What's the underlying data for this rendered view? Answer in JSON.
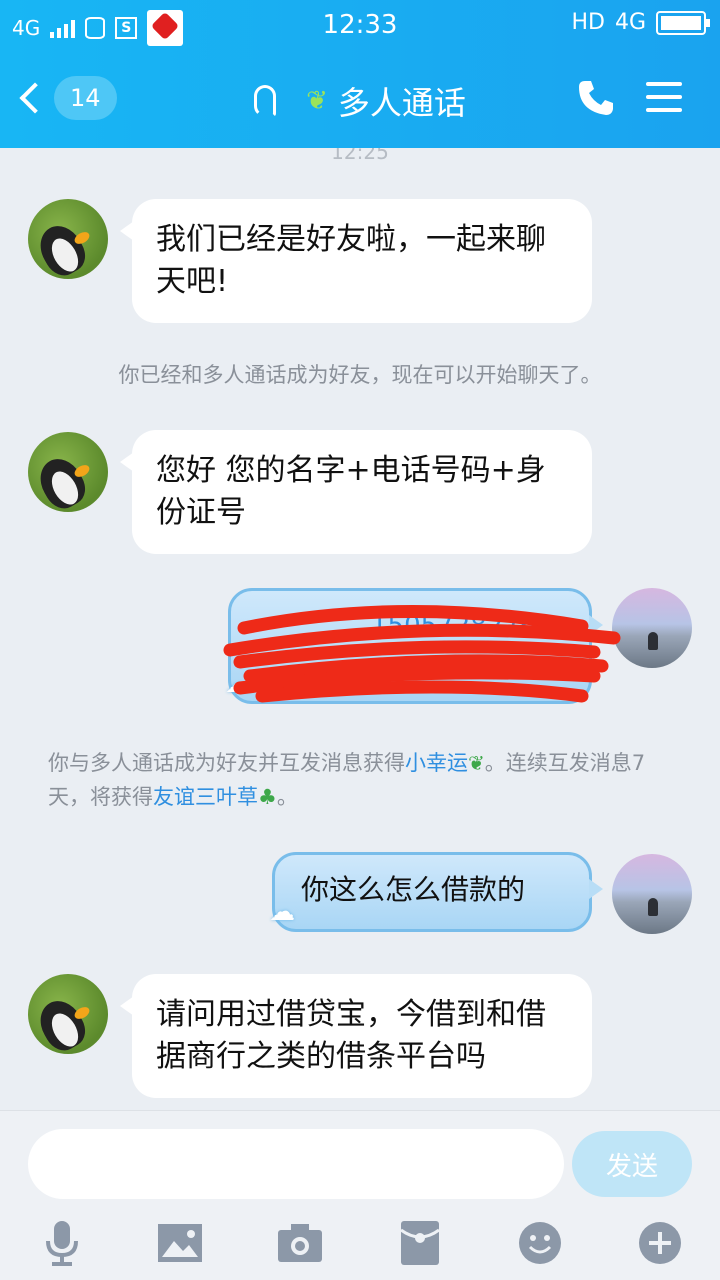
{
  "status_bar": {
    "network_left": "4G",
    "time": "12:33",
    "hd_label": "HD",
    "network_right": "4G"
  },
  "header": {
    "back_count": "14",
    "title": "多人通话"
  },
  "chat": {
    "timestamp": "12:25",
    "messages": [
      {
        "side": "left",
        "text": "我们已经是好友啦，一起来聊天吧!"
      },
      {
        "side": "left",
        "text": "您好  您的名字+电话号码+身份证号"
      },
      {
        "side": "right",
        "text": "",
        "redacted": true,
        "partial": "15057282760"
      },
      {
        "side": "right",
        "text": "你这么怎么借款的"
      },
      {
        "side": "left",
        "text": "请问用过借贷宝，今借到和借据商行之类的借条平台吗"
      }
    ],
    "system_1": "你已经和多人通话成为好友，现在可以开始聊天了。",
    "system_2": {
      "part1": "你与多人通话成为好友并互发消息获得",
      "link1": "小幸运",
      "part2": "。连续互发消息7天，将获得",
      "link2": "友谊三叶草",
      "part3": "。"
    }
  },
  "input": {
    "placeholder": "",
    "send_label": "发送"
  },
  "toolbar": {
    "items": [
      "microphone-icon",
      "image-icon",
      "camera-icon",
      "red-packet-icon",
      "emoji-icon",
      "plus-icon"
    ]
  },
  "colors": {
    "header": "#1aa3ef",
    "link": "#2f8fe0",
    "redaction": "#ee2a18"
  }
}
